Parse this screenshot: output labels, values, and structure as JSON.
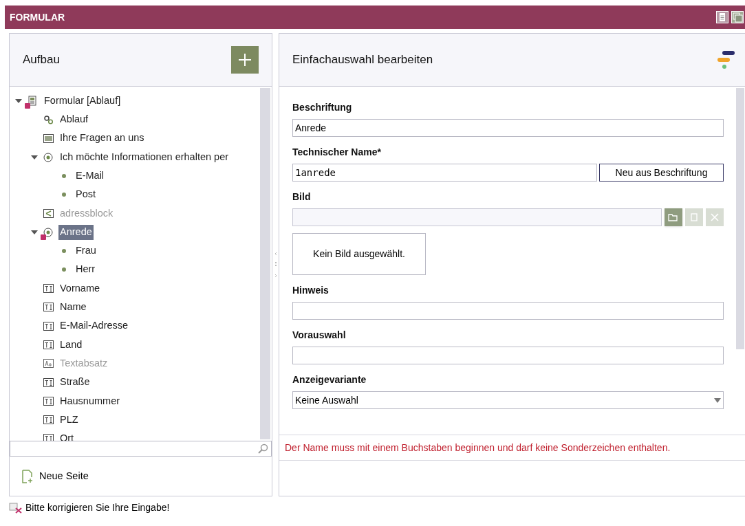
{
  "window": {
    "title": "FORMULAR"
  },
  "structure": {
    "title": "Aufbau",
    "tree": [
      {
        "label": "Formular [Ablauf]",
        "kind": "page",
        "error": true,
        "expanded": true,
        "selected": false,
        "disabled": false,
        "children": [
          {
            "label": "Ablauf",
            "kind": "flow",
            "error": false,
            "selected": false,
            "disabled": false
          },
          {
            "label": "Ihre Fragen an uns",
            "kind": "textarea",
            "error": false,
            "selected": false,
            "disabled": false
          },
          {
            "label": "Ich möchte Informationen erhalten per",
            "kind": "radio",
            "error": false,
            "expanded": true,
            "selected": false,
            "disabled": false,
            "children": [
              {
                "label": "E-Mail",
                "kind": "option",
                "error": false,
                "selected": false,
                "disabled": false
              },
              {
                "label": "Post",
                "kind": "option",
                "error": false,
                "selected": false,
                "disabled": false
              }
            ]
          },
          {
            "label": "adressblock",
            "kind": "group",
            "error": false,
            "selected": false,
            "disabled": true
          },
          {
            "label": "Anrede",
            "kind": "radio",
            "error": true,
            "expanded": true,
            "selected": true,
            "disabled": false,
            "children": [
              {
                "label": "Frau",
                "kind": "option",
                "error": false,
                "selected": false,
                "disabled": false
              },
              {
                "label": "Herr",
                "kind": "option",
                "error": false,
                "selected": false,
                "disabled": false
              }
            ]
          },
          {
            "label": "Vorname",
            "kind": "textinput",
            "error": false,
            "selected": false,
            "disabled": false
          },
          {
            "label": "Name",
            "kind": "textinput",
            "error": false,
            "selected": false,
            "disabled": false
          },
          {
            "label": "E-Mail-Adresse",
            "kind": "textinput",
            "error": false,
            "selected": false,
            "disabled": false
          },
          {
            "label": "Land",
            "kind": "textinput",
            "error": false,
            "selected": false,
            "disabled": false
          },
          {
            "label": "Textabsatz",
            "kind": "textblock",
            "error": false,
            "selected": false,
            "disabled": true
          },
          {
            "label": "Straße",
            "kind": "textinput",
            "error": false,
            "selected": false,
            "disabled": false
          },
          {
            "label": "Hausnummer",
            "kind": "textinput",
            "error": false,
            "selected": false,
            "disabled": false
          },
          {
            "label": "PLZ",
            "kind": "textinput",
            "error": false,
            "selected": false,
            "disabled": false
          },
          {
            "label": "Ort",
            "kind": "textinput",
            "error": false,
            "selected": false,
            "disabled": false
          }
        ]
      }
    ],
    "new_page": "Neue Seite"
  },
  "editor": {
    "title": "Einfachauswahl bearbeiten",
    "fields": [
      {
        "kind": "text",
        "label": "Beschriftung",
        "value": "Anrede"
      },
      {
        "kind": "text-button",
        "label": "Technischer Name*",
        "value": "1anrede",
        "button": "Neu aus Beschriftung"
      },
      {
        "kind": "image",
        "label": "Bild",
        "preview": "Kein Bild ausgewählt."
      },
      {
        "kind": "text",
        "label": "Hinweis"
      },
      {
        "kind": "text",
        "label": "Vorauswahl"
      },
      {
        "kind": "select",
        "label": "Anzeigevariante",
        "value": "Keine Auswahl"
      }
    ],
    "error": "Der Name muss mit einem Buchstaben beginnen und darf keine Sonderzeichen enthalten."
  },
  "status_bar": {
    "message": "Bitte korrigieren Sie Ihre Eingabe!"
  }
}
